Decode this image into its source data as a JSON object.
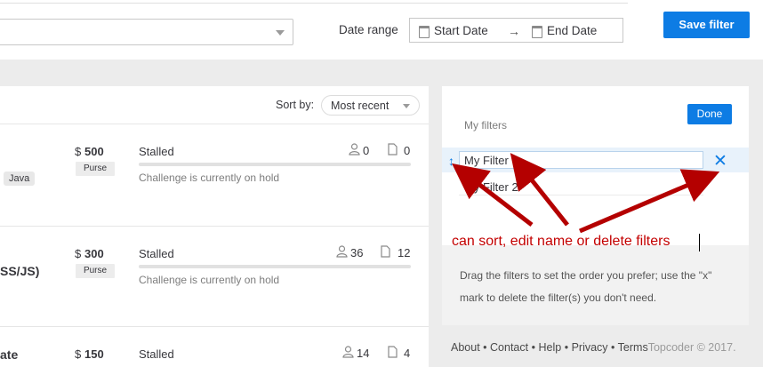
{
  "header": {
    "date_range_label": "Date range",
    "start_date": "Start Date",
    "end_date": "End Date",
    "save_filter_label": "Save filter"
  },
  "list": {
    "sort_label": "Sort by:",
    "sort_value": "Most recent",
    "rows": [
      {
        "title_fragment": "",
        "tag": "Java",
        "dollar": "$",
        "amount": "500",
        "purse_label": "Purse",
        "status": "Stalled",
        "note": "Challenge is currently on hold",
        "registrants": "0",
        "submissions": "0"
      },
      {
        "title_fragment": "SS/JS)",
        "dollar": "$",
        "amount": "300",
        "purse_label": "Purse",
        "status": "Stalled",
        "note": "Challenge is currently on hold",
        "registrants": "36",
        "submissions": "12"
      },
      {
        "title_fragment": "ate",
        "dollar": "$",
        "amount": "150",
        "status": "Stalled",
        "registrants": "14",
        "submissions": "4"
      }
    ]
  },
  "filters_panel": {
    "heading": "My filters",
    "done_label": "Done",
    "filters": [
      {
        "name": "My Filter 1"
      },
      {
        "name": "My Filter 2"
      }
    ],
    "help_text": "Drag the filters to set the order you prefer; use the \"x\" mark to delete the filter(s) you don't need."
  },
  "annotation": {
    "text": "can sort, edit name or delete filters",
    "color": "#c30000"
  },
  "footer": {
    "links": [
      "About",
      "Contact",
      "Help",
      "Privacy",
      "Terms"
    ],
    "separator": "•",
    "copyright": "Topcoder © 2017."
  },
  "colors": {
    "accent": "#0d7ce4",
    "background": "#ececec"
  }
}
